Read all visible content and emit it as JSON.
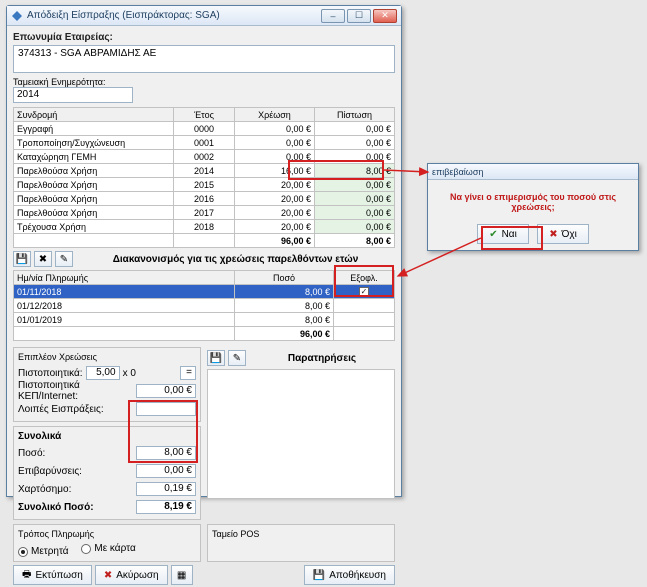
{
  "window": {
    "title": "Απόδειξη Είσπραξης (Εισπράκτορας: SGA)"
  },
  "company": {
    "label": "Επωνυμία Εταιρείας:",
    "value": "374313 - SGA ΑΒΡΑΜΙΔΗΣ ΑΕ"
  },
  "tameio": {
    "label": "Ταμειακή Ενημερότητα:",
    "value": "2014"
  },
  "dues": {
    "headers": {
      "sub": "Συνδρομή",
      "year": "Έτος",
      "debit": "Χρέωση",
      "credit": "Πίστωση"
    },
    "rows": [
      {
        "sub": "Εγγραφή",
        "year": "0000",
        "debit": "0,00 €",
        "credit": "0,00 €"
      },
      {
        "sub": "Τροποποίηση/Συγχώνευση",
        "year": "0001",
        "debit": "0,00 €",
        "credit": "0,00 €"
      },
      {
        "sub": "Καταχώρηση ΓΕΜΗ",
        "year": "0002",
        "debit": "0,00 €",
        "credit": "0,00 €"
      },
      {
        "sub": "Παρελθούσα Χρήση",
        "year": "2014",
        "debit": "16,00 €",
        "credit": "8,00 €",
        "greenCredit": true
      },
      {
        "sub": "Παρελθούσα Χρήση",
        "year": "2015",
        "debit": "20,00 €",
        "credit": "0,00 €",
        "greenCredit": true
      },
      {
        "sub": "Παρελθούσα Χρήση",
        "year": "2016",
        "debit": "20,00 €",
        "credit": "0,00 €",
        "greenCredit": true
      },
      {
        "sub": "Παρελθούσα Χρήση",
        "year": "2017",
        "debit": "20,00 €",
        "credit": "0,00 €",
        "greenCredit": true
      },
      {
        "sub": "Τρέχουσα Χρήση",
        "year": "2018",
        "debit": "20,00 €",
        "credit": "0,00 €",
        "greenCredit": true
      }
    ],
    "totals": {
      "debit": "96,00 €",
      "credit": "8,00 €"
    }
  },
  "settlement": {
    "title": "Διακανονισμός για τις χρεώσεις παρελθόντων ετών",
    "headers": {
      "date": "Ημ/νία Πληρωμής",
      "amount": "Ποσό",
      "paid": "Εξοφλ."
    },
    "rows": [
      {
        "date": "01/11/2018",
        "amount": "8,00 €",
        "paid": true,
        "selected": true
      },
      {
        "date": "01/12/2018",
        "amount": "8,00 €"
      },
      {
        "date": "01/01/2019",
        "amount": "8,00 €"
      }
    ],
    "total": "96,00 €"
  },
  "extra": {
    "title": "Επιπλέον Χρεώσεις",
    "cert_label": "Πιστοποιητικά:",
    "cert_qty": "5,00",
    "cert_mul": "x 0",
    "kep_label": "Πιστοποιητικά KEΠ/Internet:",
    "kep_val": "0,00 €",
    "other_label": "Λοιπές Εισπράξεις:"
  },
  "totals_panel": {
    "title": "Συνολικά",
    "poso_label": "Ποσό:",
    "poso": "8,00 €",
    "epib_label": "Επιβαρύνσεις:",
    "epib": "0,00 €",
    "xart_label": "Χαρτόσημο:",
    "xart": "0,19 €",
    "total_label": "Συνολικό Ποσό:",
    "total": "8,19 €"
  },
  "remarks": {
    "title": "Παρατηρήσεις"
  },
  "payment": {
    "title": "Τρόπος Πληρωμής",
    "cash": "Μετρητά",
    "card": "Με κάρτα"
  },
  "pos": {
    "title": "Ταμείο POS"
  },
  "footer": {
    "print": "Εκτύπωση",
    "cancel": "Ακύρωση",
    "save": "Αποθήκευση"
  },
  "dialog": {
    "title": "επιβεβαίωση",
    "text": "Να γίνει ο επιμερισμός του ποσού στις χρεώσεις;",
    "yes": "Ναι",
    "no": "Όχι"
  }
}
